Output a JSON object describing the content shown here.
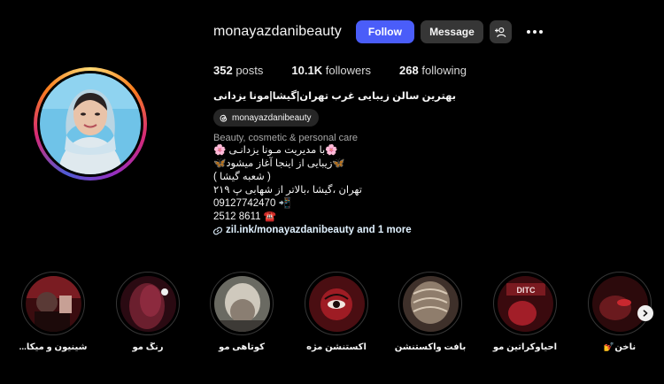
{
  "profile": {
    "username": "monayazdanibeauty",
    "follow_label": "Follow",
    "message_label": "Message",
    "add_user_icon": "add-user-icon",
    "more_icon": "more-dots-icon"
  },
  "stats": {
    "posts_count": "352",
    "posts_label": "posts",
    "followers_count": "10.1K",
    "followers_label": "followers",
    "following_count": "268",
    "following_label": "following"
  },
  "bio": {
    "full_name": "بهترین سالن زیبایی غرب تهران|گیشا|مونا یزدانی",
    "threads_handle": "monayazdanibeauty",
    "category": "Beauty, cosmetic & personal care",
    "lines": [
      "🌸با مدیریت مـونا یزدانـی 🌸",
      "🦋زیبایی از اینجا آغاز میشود🦋",
      "( شعبه گیشا )",
      "تهران ،گیشا ،بالاتر از شهابی پ ۲۱۹",
      "09127742470 📲",
      "2512 8611 ☎️"
    ],
    "link_text": "zil.ink/monayazdanibeauty and 1 more",
    "link_icon": "link-icon"
  },
  "highlights": [
    {
      "label": "شینیون و میکا..."
    },
    {
      "label": "رنگ مو"
    },
    {
      "label": "کوتاهی مو"
    },
    {
      "label": "اکستنشن مژه"
    },
    {
      "label": "بافت واکستنشن"
    },
    {
      "label": "احیاوکراتین مو"
    },
    {
      "label": "ناخن💅"
    }
  ],
  "colors": {
    "follow_button": "#4a5df9",
    "secondary_button": "#363636",
    "background": "#000000"
  }
}
